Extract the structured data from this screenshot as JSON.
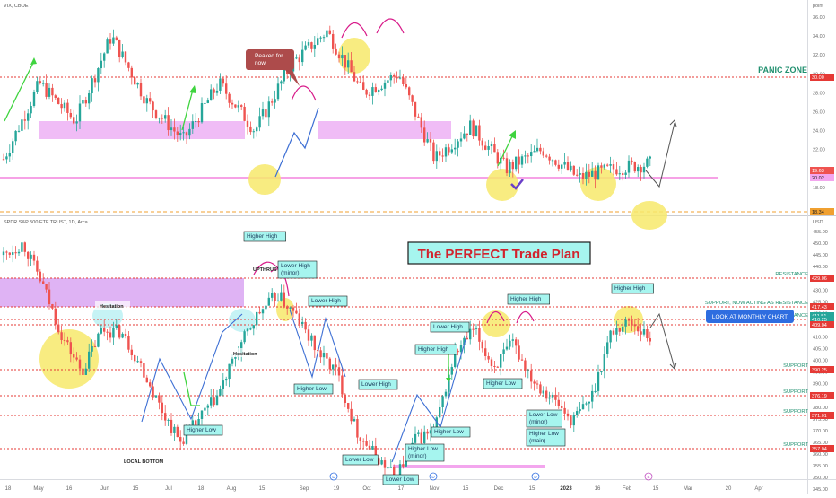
{
  "vix_panel": {
    "symbol_label": "VIX, CBOE",
    "scale_label": "point",
    "panic_zone_label": "PANIC ZONE",
    "peaked_note": "Peaked for\nnow",
    "price_ticks": [
      "36.00",
      "34.00",
      "32.00",
      "30.00",
      "28.00",
      "26.00",
      "24.00",
      "22.00",
      "20.00",
      "18.00"
    ],
    "line_30_tag": "30.00",
    "line_20_tag": "20.02",
    "current_tag": "19.63",
    "low_tag": "18.34",
    "colors": {
      "bull": "#26a69a",
      "bear": "#ef5350",
      "panic_line": "#e53935",
      "zone": "#e699f0",
      "highlight": "#f7e96b",
      "arrow_green": "#3fd43f",
      "arrow_blue": "#3d6fd4",
      "arc": "#d81b8a"
    }
  },
  "spy_panel": {
    "symbol_label": "SPDR S&P 500 ETF TRUST, 1D, Arca",
    "scale_label": "USD",
    "title": "The PERFECT Trade Plan",
    "monthly_note": "LOOK AT MONTHLY CHART",
    "price_ticks": [
      "455.00",
      "450.00",
      "445.00",
      "440.00",
      "435.00",
      "430.00",
      "425.00",
      "420.00",
      "415.00",
      "410.00",
      "405.00",
      "400.00",
      "395.00",
      "390.00",
      "385.00",
      "380.00",
      "375.00",
      "370.00",
      "365.00",
      "360.00",
      "355.00",
      "350.00",
      "345.00"
    ],
    "level_tags": [
      "429.06",
      "417.43",
      "411.51",
      "410.25",
      "409.04",
      "390.25",
      "376.19",
      "371.01",
      "357.04"
    ],
    "level_labels": [
      "RESISTANCE",
      "SUPPORT, NOW ACTING AS RESISTANCE",
      "ANCE",
      "SUPPORT",
      "SUPPORT",
      "SUPPORT",
      "SUPPORT"
    ],
    "annotations": {
      "higher_high_1": "Higher High",
      "upthrust": "UPTHRUST",
      "lower_high_minor": "Lower High\n(minor)",
      "lower_high_1": "Lower High",
      "hesitation_1": "Hesitation",
      "hesitation_2": "Hesitation",
      "higher_low_1": "Higher Low",
      "local_bottom": "LOCAL BOTTOM",
      "higher_low_2": "Higher Low",
      "lower_high_2": "Lower High",
      "lower_low_1": "Lower Low",
      "lower_low_2": "Lower Low",
      "higher_low_minor": "Higher Low\n(minor)",
      "higher_high_2": "Higher High",
      "lower_high_3": "Lower High",
      "higher_low_3": "Higher Low",
      "higher_high_3": "Higher High",
      "higher_low_4": "Higher Low",
      "lower_low_minor": "Lower Low\n(minor)",
      "higher_low_main": "Higher Low\n(main)",
      "higher_high_4": "Higher High"
    },
    "event_markers": [
      "D",
      "D",
      "D",
      "E"
    ]
  },
  "time_axis": [
    "18",
    "May",
    "16",
    "Jun",
    "15",
    "Jul",
    "18",
    "Aug",
    "15",
    "Sep",
    "19",
    "Oct",
    "17",
    "Nov",
    "15",
    "Dec",
    "15",
    "2023",
    "16",
    "Feb",
    "15",
    "Mar",
    "20",
    "Apr"
  ],
  "chart_data": [
    {
      "type": "candlestick",
      "title": "VIX, CBOE",
      "ylabel": "point",
      "ylim": [
        17.5,
        37
      ],
      "x": [
        "Apr",
        "May",
        "Jun",
        "Jul",
        "Aug",
        "Sep",
        "Oct",
        "Nov",
        "Dec",
        "Jan",
        "Feb"
      ],
      "approx_path": [
        21,
        29,
        25,
        34,
        27,
        23,
        29,
        24,
        31,
        34.5,
        28,
        30,
        21,
        24.5,
        20,
        22,
        19,
        20,
        20.5
      ]
    },
    {
      "type": "candlestick",
      "title": "SPDR S&P 500 ETF TRUST, 1D, Arca",
      "ylabel": "USD",
      "ylim": [
        343,
        458
      ],
      "approx_path": [
        445,
        450,
        432,
        410,
        395,
        413,
        412,
        398,
        380,
        365,
        375,
        386,
        405,
        420,
        428,
        418,
        404,
        395,
        370,
        359,
        350,
        366,
        370,
        402,
        413,
        397,
        407,
        392,
        384,
        374,
        384,
        412,
        417,
        409
      ]
    }
  ]
}
